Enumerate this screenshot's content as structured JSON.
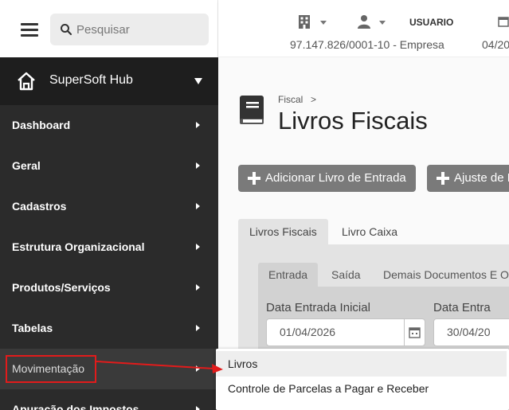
{
  "search": {
    "placeholder": "Pesquisar"
  },
  "brand": {
    "label": "SuperSoft Hub"
  },
  "menu": [
    {
      "label": "Dashboard"
    },
    {
      "label": "Geral"
    },
    {
      "label": "Cadastros"
    },
    {
      "label": "Estrutura Organizacional"
    },
    {
      "label": "Produtos/Serviços"
    },
    {
      "label": "Tabelas"
    },
    {
      "label": "Movimentação"
    },
    {
      "label": "Apuração dos Impostos"
    }
  ],
  "topbar": {
    "user": "USUARIO",
    "company": "97.147.826/0001-10 - Empresa",
    "date": "04/20"
  },
  "breadcrumb": {
    "section": "Fiscal",
    "separator": ">"
  },
  "page": {
    "title": "Livros Fiscais"
  },
  "actions": {
    "add_entry": "Adicionar Livro de Entrada",
    "adjust": "Ajuste de L"
  },
  "tabs": [
    "Livros Fiscais",
    "Livro Caixa"
  ],
  "subtabs": [
    "Entrada",
    "Saída",
    "Demais Documentos E Op"
  ],
  "filters": {
    "start_label": "Data Entrada Inicial",
    "start_value": "01/04/2026",
    "end_label": "Data Entra",
    "end_value": "30/04/20"
  },
  "submenu": [
    "Livros",
    "Controle de Parcelas a Pagar e Receber"
  ],
  "colors": {
    "sidebar": "#2b2b2b",
    "highlight": "#e21b1b",
    "button": "#7a7a7a"
  }
}
